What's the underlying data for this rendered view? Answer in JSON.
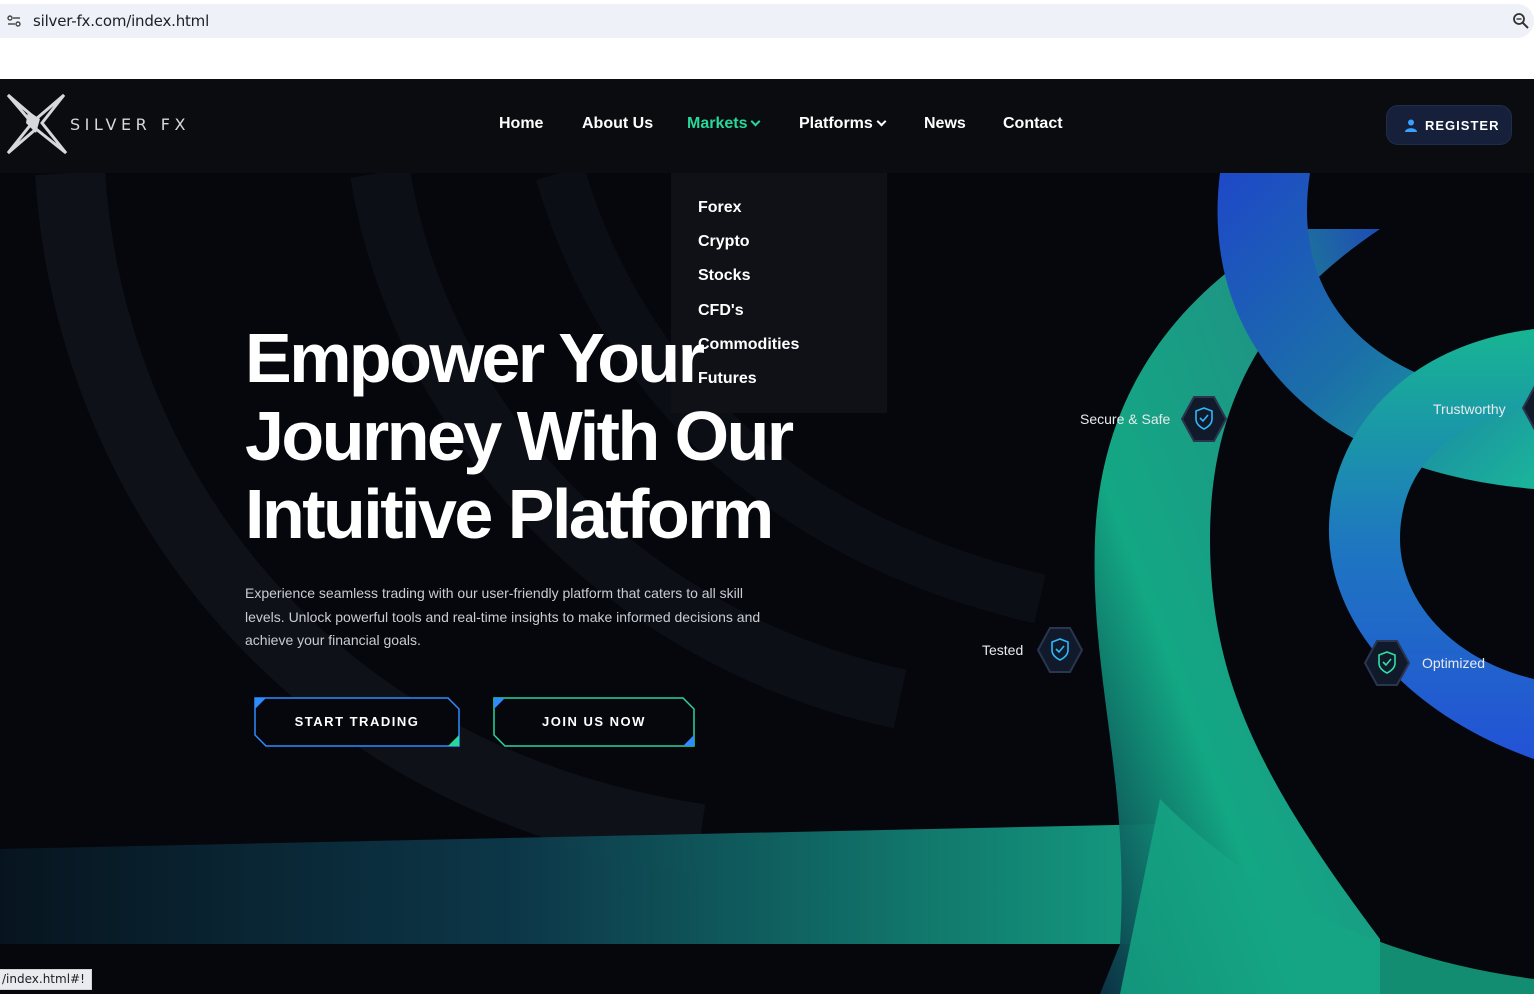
{
  "browser": {
    "url": "silver-fx.com/index.html",
    "status_url": "/index.html#!"
  },
  "header": {
    "logo_text": "SILVER FX",
    "nav": [
      {
        "label": "Home"
      },
      {
        "label": "About Us"
      },
      {
        "label": "Markets",
        "active": true,
        "has_caret": true
      },
      {
        "label": "Platforms",
        "has_caret": true
      },
      {
        "label": "News"
      },
      {
        "label": "Contact"
      }
    ],
    "register_label": "REGISTER"
  },
  "markets_dropdown": {
    "items": [
      "Forex",
      "Crypto",
      "Stocks",
      "CFD's",
      "Commodities",
      "Futures"
    ]
  },
  "hero": {
    "title_lines": [
      "Empower Your",
      "Journey With Our",
      "Intuitive Platform"
    ],
    "description": "Experience seamless trading with our user-friendly platform that caters to all skill levels. Unlock powerful tools and real-time insights to make informed decisions and achieve your financial goals.",
    "buttons": {
      "start_trading": "START TRADING",
      "join_us": "JOIN US NOW"
    }
  },
  "features": {
    "secure": "Secure & Safe",
    "trustworthy": "Trustworthy",
    "tested": "Tested",
    "optimized": "Optimized"
  },
  "colors": {
    "accent_green": "#28d79a",
    "accent_blue": "#2f6bff",
    "background": "#05070d",
    "header": "#0b0c10"
  },
  "icons": [
    "site-info-icon",
    "zoom-icon",
    "silver-fx-logo",
    "user-icon",
    "shield-check-icon"
  ]
}
